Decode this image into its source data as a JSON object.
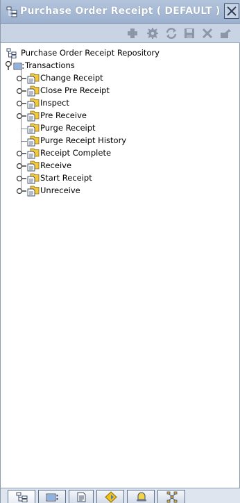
{
  "window": {
    "title": "Purchase Order Receipt ( DEFAULT )"
  },
  "toolbar": {
    "buttons": [
      {
        "name": "add-icon",
        "label": "Add"
      },
      {
        "name": "gear-icon",
        "label": "Details"
      },
      {
        "name": "refresh-icon",
        "label": "Refresh"
      },
      {
        "name": "save-icon",
        "label": "Save"
      },
      {
        "name": "delete-icon",
        "label": "Delete"
      },
      {
        "name": "export-icon",
        "label": "Export"
      }
    ]
  },
  "tree": {
    "root": {
      "label": "Purchase Order Receipt Repository"
    },
    "transactions": {
      "label": "Transactions"
    },
    "items": [
      {
        "label": "Change Receipt",
        "expandable": true
      },
      {
        "label": "Close Pre Receipt",
        "expandable": true
      },
      {
        "label": "Inspect",
        "expandable": true
      },
      {
        "label": "Pre Receive",
        "expandable": true
      },
      {
        "label": "Purge Receipt",
        "expandable": false
      },
      {
        "label": "Purge Receipt History",
        "expandable": false
      },
      {
        "label": "Receipt Complete",
        "expandable": true
      },
      {
        "label": "Receive",
        "expandable": true
      },
      {
        "label": "Start Receipt",
        "expandable": true
      },
      {
        "label": "Unreceive",
        "expandable": true
      }
    ]
  },
  "bottom_tabs": [
    {
      "name": "tree-icon",
      "active": true
    },
    {
      "name": "transactions-icon",
      "active": false
    },
    {
      "name": "document-icon",
      "active": false
    },
    {
      "name": "diamond-icon",
      "active": false
    },
    {
      "name": "alert-icon",
      "active": false
    },
    {
      "name": "network-icon",
      "active": false
    }
  ],
  "colors": {
    "titlebar": "#9cb1cf",
    "toolbar": "#c8d3e3",
    "tree_background": "#ffffff",
    "folder": "#f0c040"
  }
}
